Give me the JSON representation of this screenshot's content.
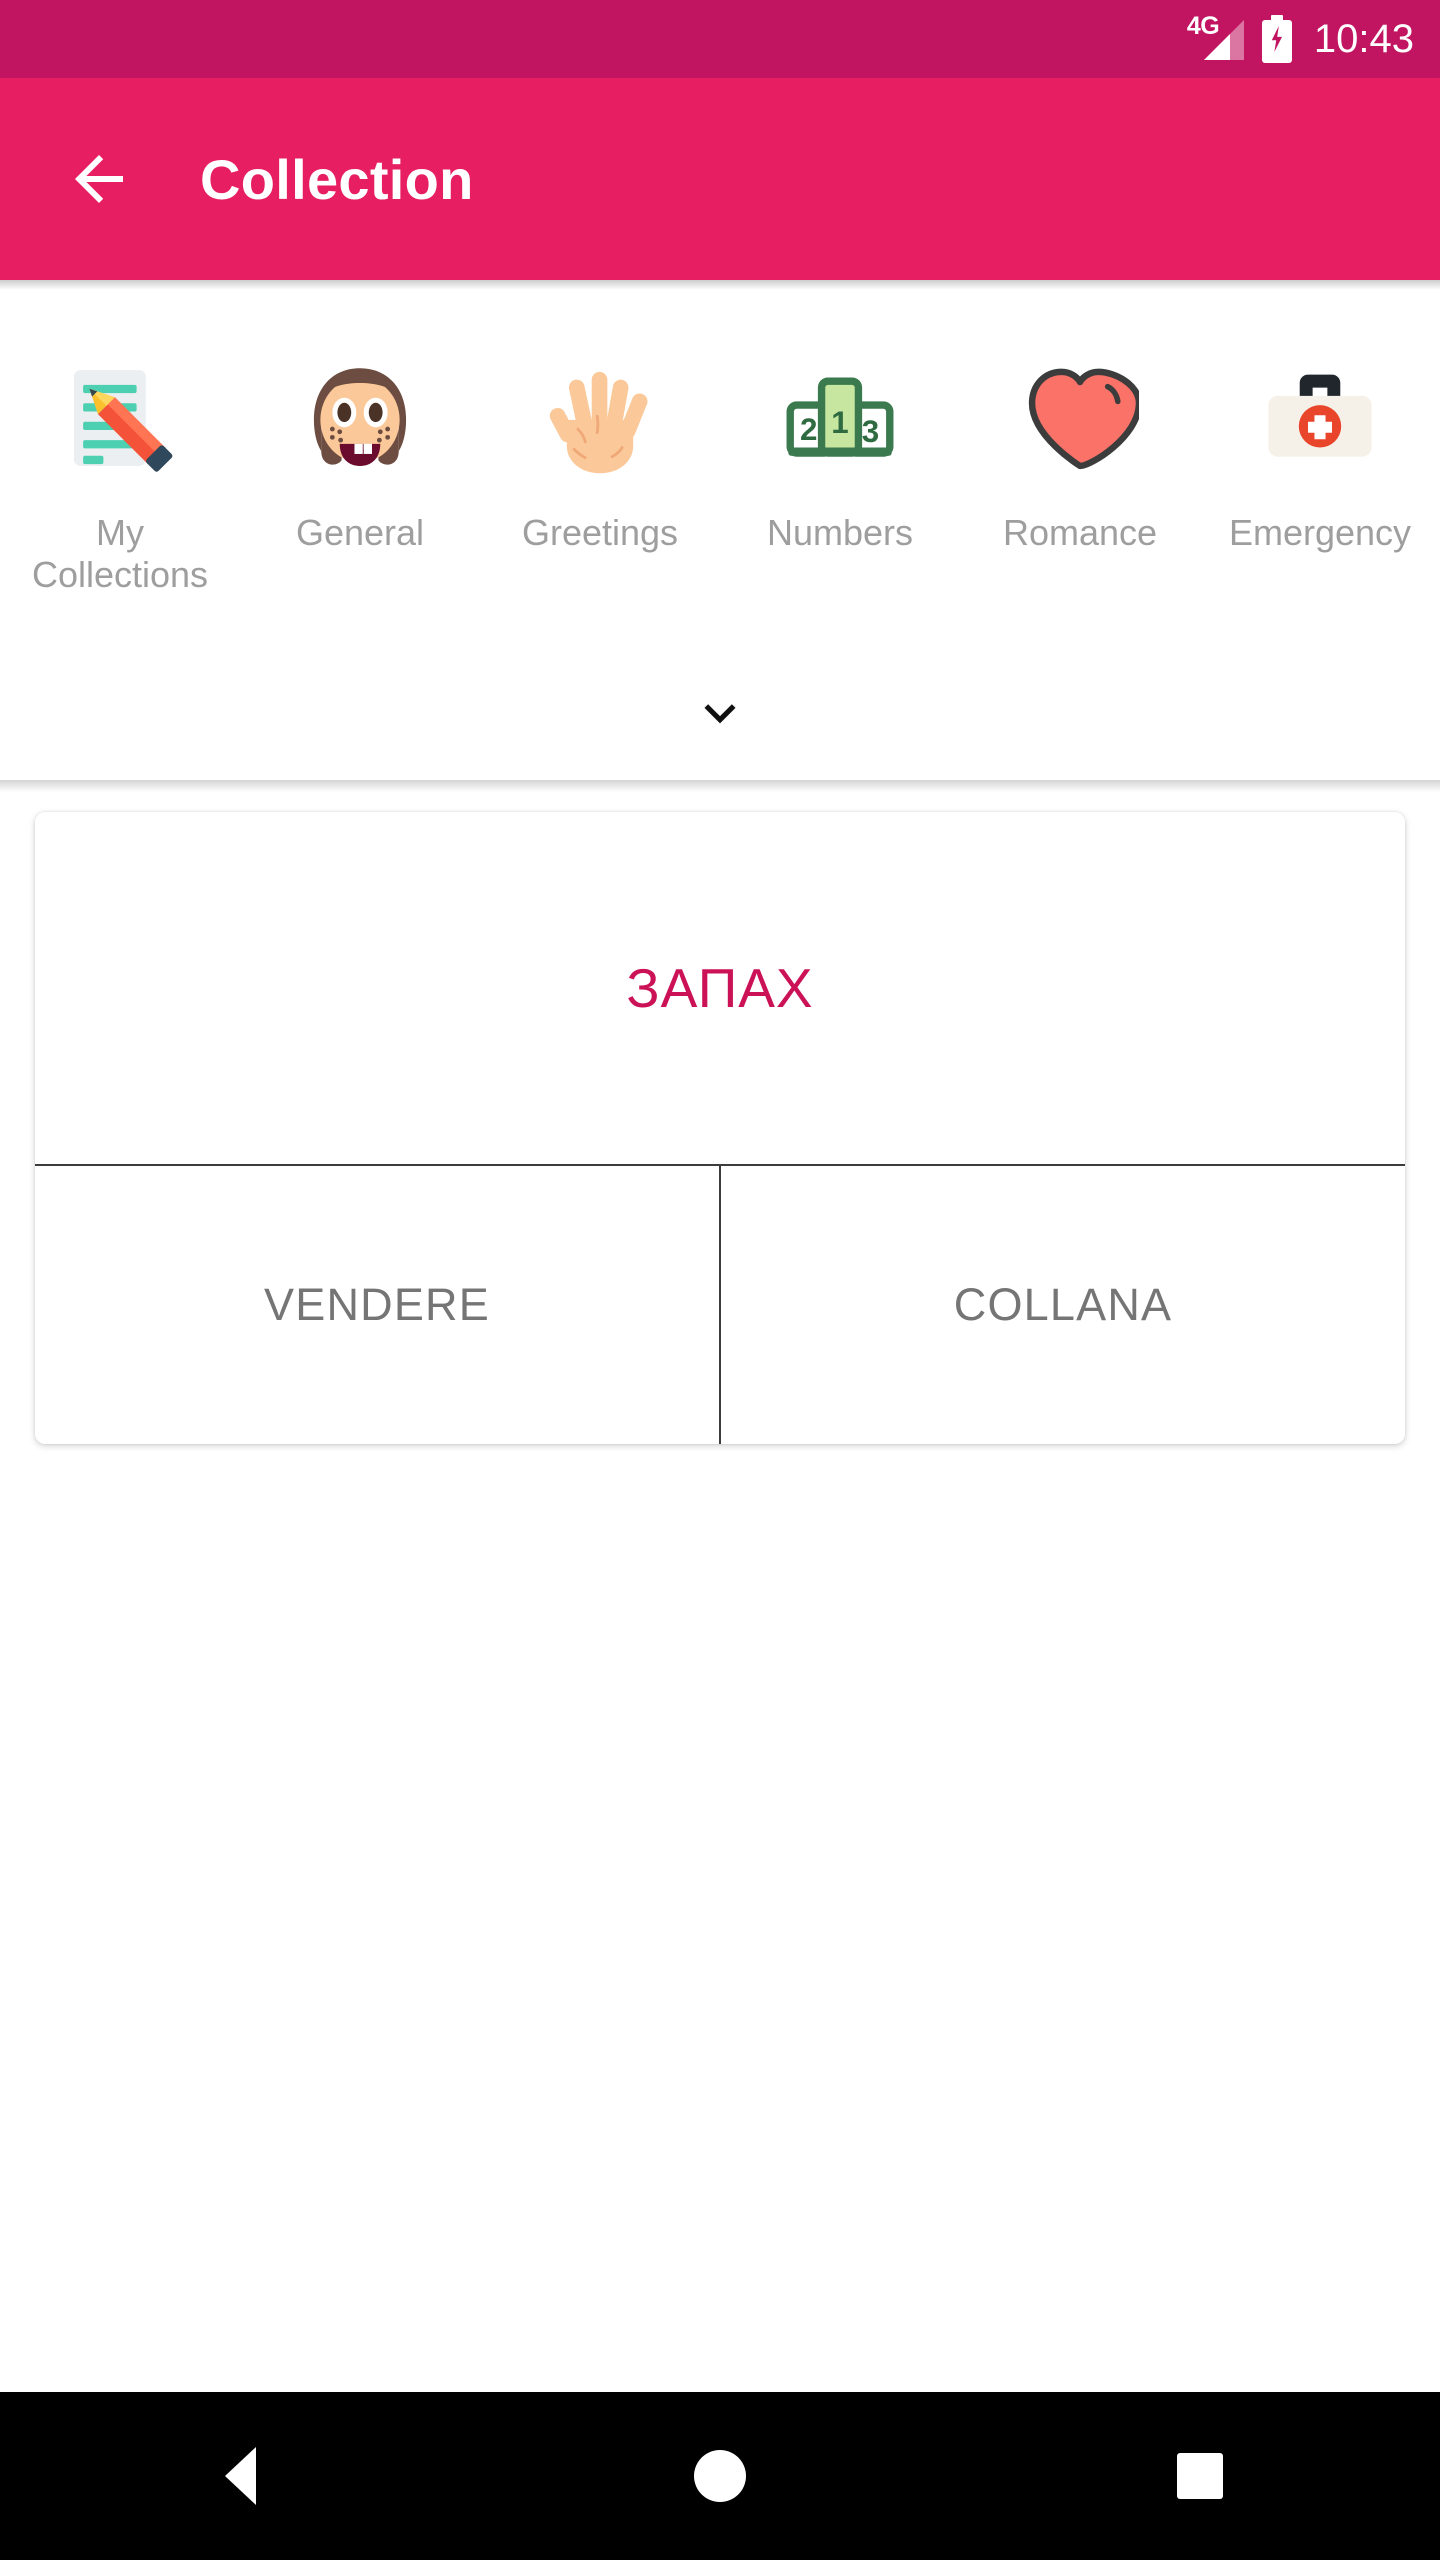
{
  "status_bar": {
    "network_label": "4G",
    "signal_icon": "signal-bars-icon",
    "battery_icon": "battery-charging-icon",
    "time": "10:43",
    "background_color": "#c11461"
  },
  "app_bar": {
    "back_icon": "arrow-left-icon",
    "title": "Collection",
    "background_color": "#e81e63",
    "text_color": "#ffffff"
  },
  "categories": {
    "expander_icon": "chevron-down-icon",
    "items": [
      {
        "label": "My Collections",
        "icon": "memo-pencil-icon"
      },
      {
        "label": "General",
        "icon": "girl-face-icon"
      },
      {
        "label": "Greetings",
        "icon": "open-hand-icon"
      },
      {
        "label": "Numbers",
        "icon": "podium-icon"
      },
      {
        "label": "Romance",
        "icon": "heart-icon"
      },
      {
        "label": "Emergency",
        "icon": "first-aid-kit-icon"
      }
    ]
  },
  "flashcard": {
    "prompt_word": "ЗАПАХ",
    "prompt_color": "#cc1257",
    "option_left": "VENDERE",
    "option_right": "COLLANA",
    "option_color": "#757575"
  },
  "nav_bar": {
    "back_icon": "nav-back-triangle-icon",
    "home_icon": "nav-home-circle-icon",
    "recents_icon": "nav-recents-square-icon"
  }
}
